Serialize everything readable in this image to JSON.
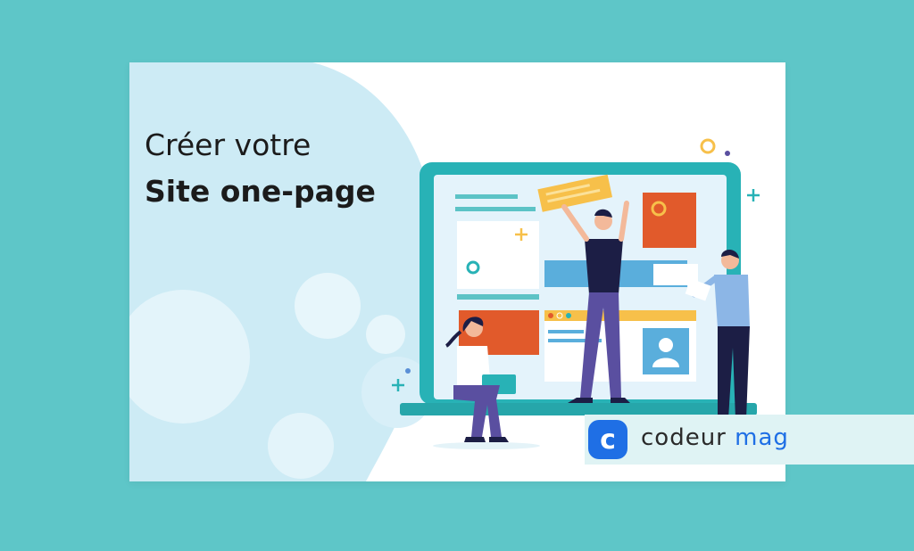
{
  "colors": {
    "page_background": "#5ec6c8",
    "card_background": "#ffffff",
    "blob": "#cdebf5",
    "monitor_frame": "#28b2b6",
    "accent_orange": "#e15a2b",
    "accent_yellow": "#f7c04a",
    "brand_blue": "#1f6fe5"
  },
  "headline": {
    "line1": "Créer votre",
    "line2": "Site one-page"
  },
  "brand": {
    "logo_letter": "c",
    "word1": "codeur",
    "word2": "mag"
  },
  "illustration": {
    "icons": [
      "monitor-icon",
      "person-icon",
      "laptop-icon",
      "plus-icon",
      "circle-icon"
    ]
  }
}
